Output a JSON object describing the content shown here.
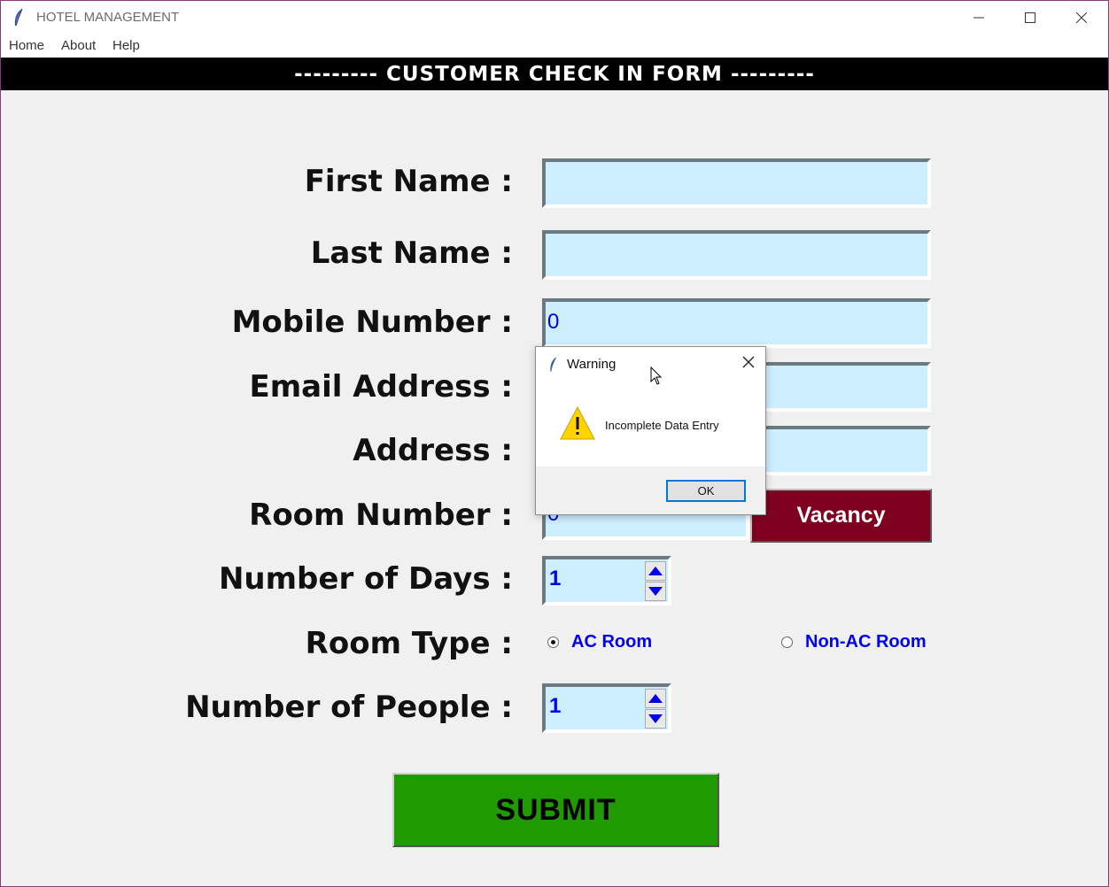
{
  "window": {
    "title": "HOTEL MANAGEMENT",
    "app_icon": "feather-icon",
    "controls": [
      "minimize-icon",
      "maximize-icon",
      "close-icon"
    ]
  },
  "menu": {
    "items": [
      {
        "label": "Home"
      },
      {
        "label": "About"
      },
      {
        "label": "Help"
      }
    ]
  },
  "header": {
    "title": "---------  CUSTOMER CHECK IN FORM  ---------"
  },
  "form": {
    "first_name": {
      "label": "First Name :",
      "value": ""
    },
    "last_name": {
      "label": "Last Name :",
      "value": ""
    },
    "mobile": {
      "label": "Mobile Number :",
      "value": "0"
    },
    "email": {
      "label": "Email Address :",
      "value": ""
    },
    "address": {
      "label": "Address :",
      "value": ""
    },
    "room_number": {
      "label": "Room Number :",
      "value": "0"
    },
    "vacancy_button": "Vacancy",
    "days": {
      "label": "Number of Days :",
      "value": "1"
    },
    "room_type": {
      "label": "Room Type :",
      "options": [
        {
          "label": "AC Room",
          "selected": true
        },
        {
          "label": "Non-AC Room",
          "selected": false
        }
      ]
    },
    "people": {
      "label": "Number of People :",
      "value": "1"
    },
    "submit_button": "SUBMIT"
  },
  "dialog": {
    "title": "Warning",
    "icon": "warning-icon",
    "message": "Incomplete Data Entry",
    "ok_label": "OK"
  },
  "colors": {
    "entry_bg": "#cdeefe",
    "entry_text": "#0000ee",
    "vacancy_bg": "#800020",
    "submit_bg": "#1f9a00",
    "header_bg": "#000000"
  }
}
